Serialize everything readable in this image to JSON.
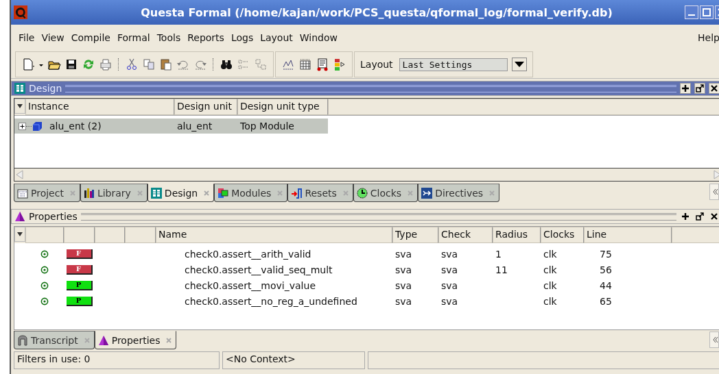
{
  "window": {
    "title": "Questa Formal (/home/kajan/work/PCS_questa/qformal_log/formal_verify.db)"
  },
  "menu": [
    {
      "label": "File"
    },
    {
      "label": "View"
    },
    {
      "label": "Compile"
    },
    {
      "label": "Formal"
    },
    {
      "label": "Tools"
    },
    {
      "label": "Reports"
    },
    {
      "label": "Logs"
    },
    {
      "label": "Layout"
    },
    {
      "label": "Window"
    }
  ],
  "help_menu": "Help",
  "toolbar": {
    "layout_label": "Layout",
    "layout_value": "Last Settings"
  },
  "design_panel": {
    "title": "Design",
    "active": true,
    "columns": [
      "Instance",
      "Design unit",
      "Design unit type"
    ],
    "rows": [
      {
        "instance": "alu_ent (2)",
        "design_unit": "alu_ent",
        "design_unit_type": "Top Module",
        "expanded": false,
        "selected": true
      }
    ]
  },
  "design_tabs": [
    {
      "label": "Project",
      "selected": false
    },
    {
      "label": "Library",
      "selected": false
    },
    {
      "label": "Design",
      "selected": true
    },
    {
      "label": "Modules",
      "selected": false
    },
    {
      "label": "Resets",
      "selected": false
    },
    {
      "label": "Clocks",
      "selected": false
    },
    {
      "label": "Directives",
      "selected": false
    }
  ],
  "properties_panel": {
    "title": "Properties",
    "active": false,
    "columns": [
      "Name",
      "Type",
      "Check",
      "Radius",
      "Clocks",
      "Line"
    ],
    "rows": [
      {
        "kind": "fail",
        "result": "F",
        "name": "check0.assert__arith_valid",
        "type": "sva",
        "check": "sva",
        "radius": "1",
        "clocks": "clk",
        "line": "75"
      },
      {
        "kind": "fail",
        "result": "F",
        "name": "check0.assert__valid_seq_mult",
        "type": "sva",
        "check": "sva",
        "radius": "11",
        "clocks": "clk",
        "line": "56"
      },
      {
        "kind": "pass",
        "result": "P",
        "name": "check0.assert__movi_value",
        "type": "sva",
        "check": "sva",
        "clocks": "clk",
        "line": "44"
      },
      {
        "kind": "pass",
        "result": "P",
        "name": "check0.assert__no_reg_a_undefined",
        "type": "sva",
        "check": "sva",
        "clocks": "clk",
        "line": "65"
      }
    ]
  },
  "bottom_tabs": [
    {
      "label": "Transcript",
      "selected": false
    },
    {
      "label": "Properties",
      "selected": true
    }
  ],
  "status_bar": [
    "Filters in use: 0",
    "<No Context>"
  ]
}
